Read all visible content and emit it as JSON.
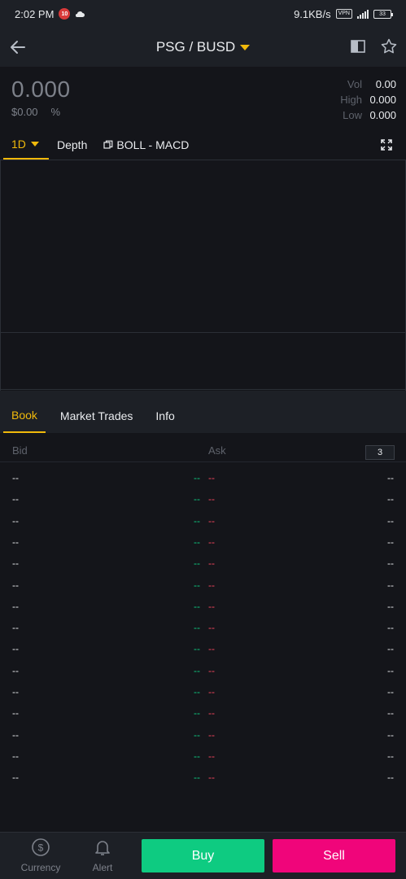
{
  "status_bar": {
    "time": "2:02 PM",
    "notif_badge": "10",
    "speed": "9.1KB/s",
    "vpn": "VPN",
    "battery": "33"
  },
  "header": {
    "pair": "PSG / BUSD",
    "accent": "#f0b90b"
  },
  "price": {
    "last": "0.000",
    "fiat": "$0.00",
    "change": "%"
  },
  "stats": [
    {
      "label": "Vol",
      "value": "0.00"
    },
    {
      "label": "High",
      "value": "0.000"
    },
    {
      "label": "Low",
      "value": "0.000"
    }
  ],
  "chart_tabs": {
    "interval": "1D",
    "depth": "Depth",
    "indicators": "BOLL - MACD"
  },
  "book_tabs": [
    "Book",
    "Market Trades",
    "Info"
  ],
  "order_book": {
    "bid_label": "Bid",
    "ask_label": "Ask",
    "depth_value": "3",
    "rows": [
      {
        "bid_qty": "--",
        "bid_price": "--",
        "ask_price": "--",
        "ask_qty": "--"
      },
      {
        "bid_qty": "--",
        "bid_price": "--",
        "ask_price": "--",
        "ask_qty": "--"
      },
      {
        "bid_qty": "--",
        "bid_price": "--",
        "ask_price": "--",
        "ask_qty": "--"
      },
      {
        "bid_qty": "--",
        "bid_price": "--",
        "ask_price": "--",
        "ask_qty": "--"
      },
      {
        "bid_qty": "--",
        "bid_price": "--",
        "ask_price": "--",
        "ask_qty": "--"
      },
      {
        "bid_qty": "--",
        "bid_price": "--",
        "ask_price": "--",
        "ask_qty": "--"
      },
      {
        "bid_qty": "--",
        "bid_price": "--",
        "ask_price": "--",
        "ask_qty": "--"
      },
      {
        "bid_qty": "--",
        "bid_price": "--",
        "ask_price": "--",
        "ask_qty": "--"
      },
      {
        "bid_qty": "--",
        "bid_price": "--",
        "ask_price": "--",
        "ask_qty": "--"
      },
      {
        "bid_qty": "--",
        "bid_price": "--",
        "ask_price": "--",
        "ask_qty": "--"
      },
      {
        "bid_qty": "--",
        "bid_price": "--",
        "ask_price": "--",
        "ask_qty": "--"
      },
      {
        "bid_qty": "--",
        "bid_price": "--",
        "ask_price": "--",
        "ask_qty": "--"
      },
      {
        "bid_qty": "--",
        "bid_price": "--",
        "ask_price": "--",
        "ask_qty": "--"
      },
      {
        "bid_qty": "--",
        "bid_price": "--",
        "ask_price": "--",
        "ask_qty": "--"
      },
      {
        "bid_qty": "--",
        "bid_price": "--",
        "ask_price": "--",
        "ask_qty": "--"
      }
    ]
  },
  "bottom_bar": {
    "currency": "Currency",
    "alert": "Alert",
    "buy": "Buy",
    "sell": "Sell",
    "buy_color": "#0ecb81",
    "sell_color": "#f0057a"
  }
}
